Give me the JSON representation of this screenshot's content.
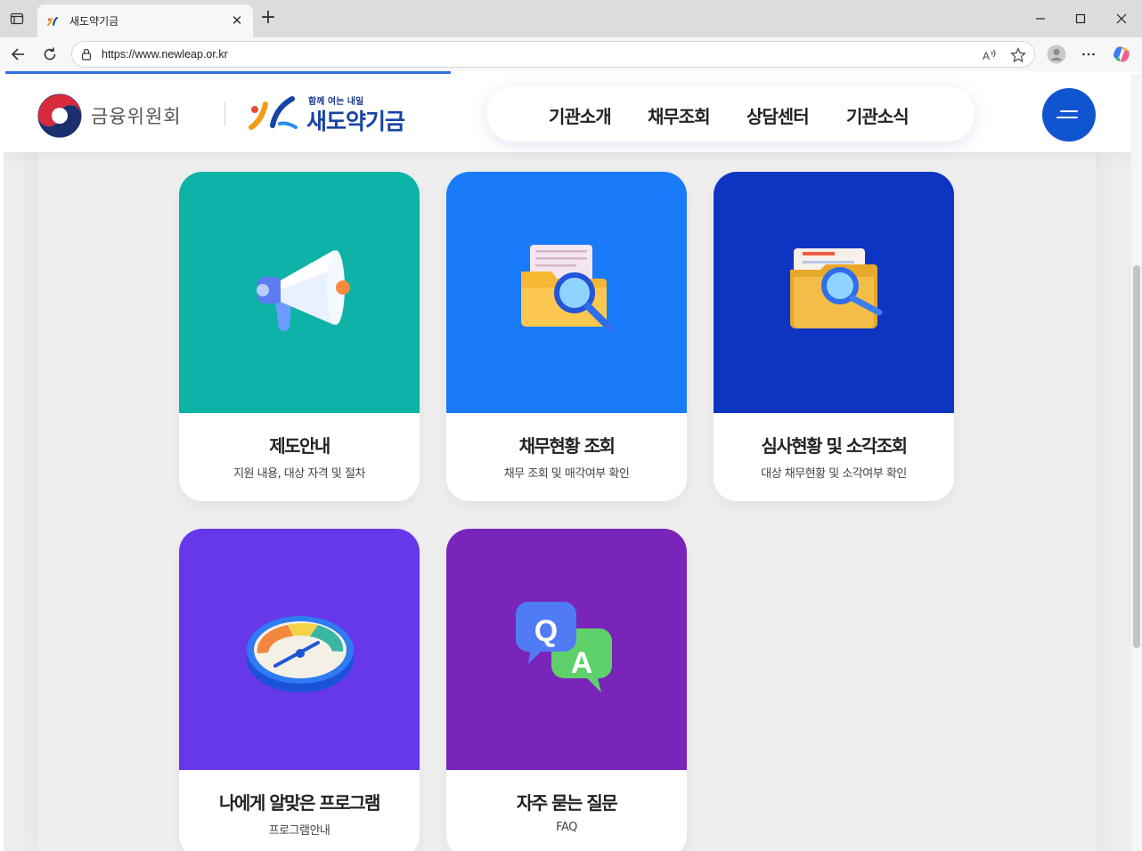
{
  "browser": {
    "tab_title": "새도약기금",
    "url": "https://www.newleap.or.kr",
    "icons": [
      "sidebar-icon",
      "close-icon",
      "plus-icon",
      "minimize-icon",
      "maximize-icon",
      "back-icon",
      "reload-icon",
      "lock-icon",
      "read-aloud-icon",
      "favorite-icon",
      "profile-icon",
      "more-icon",
      "copilot-icon"
    ]
  },
  "header": {
    "fsc_name": "금융위원회",
    "slogan": "함께 여는 내일",
    "brand_name": "새도약기금",
    "nav": [
      "기관소개",
      "채무조회",
      "상담센터",
      "기관소식"
    ],
    "accent_color": "#1154cf"
  },
  "cards": [
    {
      "title": "제도안내",
      "desc": "지원 내용, 대상 자격 및 절차",
      "color": "#0cb3a6",
      "icon": "megaphone-icon"
    },
    {
      "title": "채무현황 조회",
      "desc": "채무 조회 및 매각여부 확인",
      "color": "#1a7bfa",
      "icon": "folder-search-icon"
    },
    {
      "title": "심사현황 및 소각조회",
      "desc": "대상 채무현황 및 소각여부 확인",
      "color": "#0e35c2",
      "icon": "document-search-icon"
    },
    {
      "title": "나에게 알맞은 프로그램",
      "desc": "프로그램안내",
      "color": "#6638e9",
      "icon": "gauge-icon"
    },
    {
      "title": "자주 묻는 질문",
      "desc": "FAQ",
      "color": "#7a25b9",
      "icon": "qa-bubble-icon"
    }
  ]
}
